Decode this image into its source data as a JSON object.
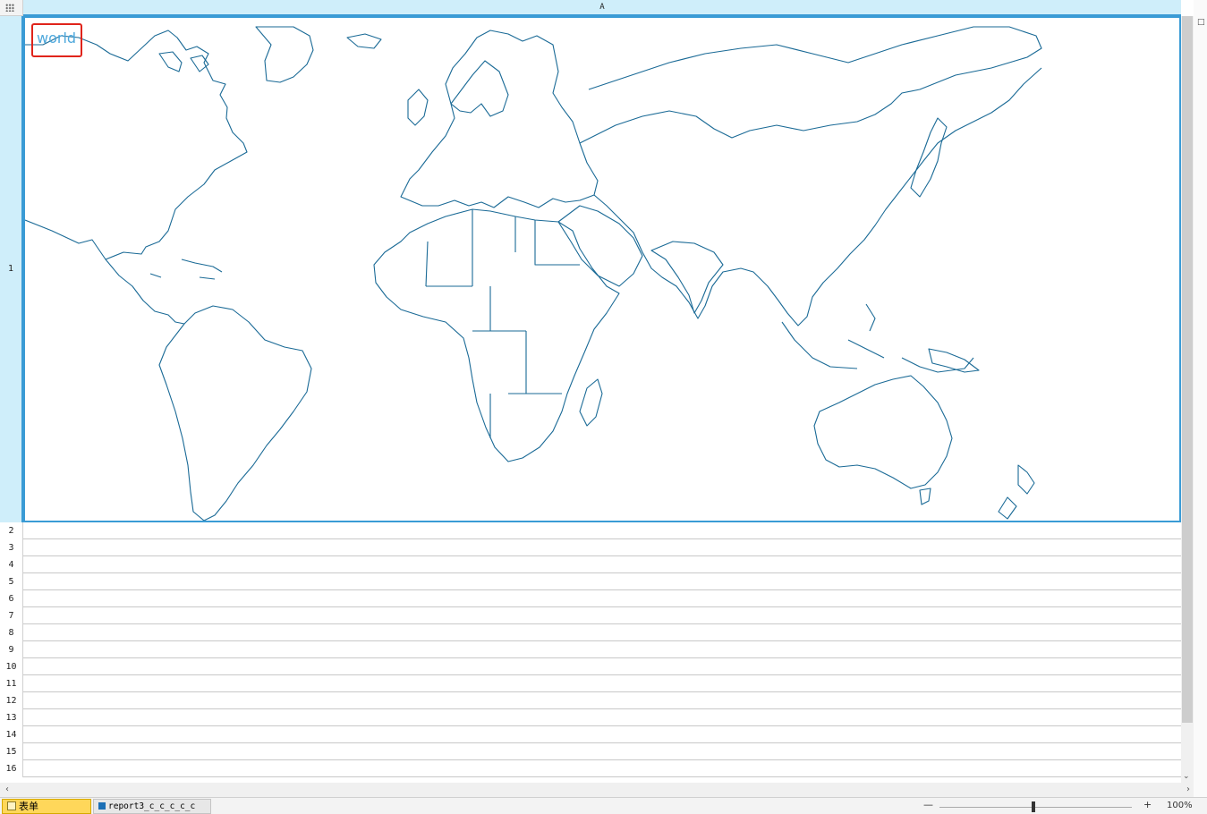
{
  "sheet": {
    "column_header": "A",
    "rows": [
      "1",
      "2",
      "3",
      "4",
      "5",
      "6",
      "7",
      "8",
      "9",
      "10",
      "11",
      "12",
      "13",
      "14",
      "15",
      "16"
    ]
  },
  "map": {
    "title": "world",
    "stroke_color": "#1a6a96",
    "title_color": "#4ea8dc",
    "highlight_color": "#e0241b"
  },
  "tabs": [
    {
      "label": "表单",
      "active": true
    },
    {
      "label": "report3_c_c_c_c_c",
      "active": false
    }
  ],
  "zoom": {
    "minus": "—",
    "plus": "+",
    "level": "100%"
  },
  "icons": {
    "corner": "grid-dots-icon",
    "scroll_down": "chevron-down-icon",
    "scroll_left": "chevron-left-icon",
    "scroll_right": "chevron-right-icon"
  }
}
